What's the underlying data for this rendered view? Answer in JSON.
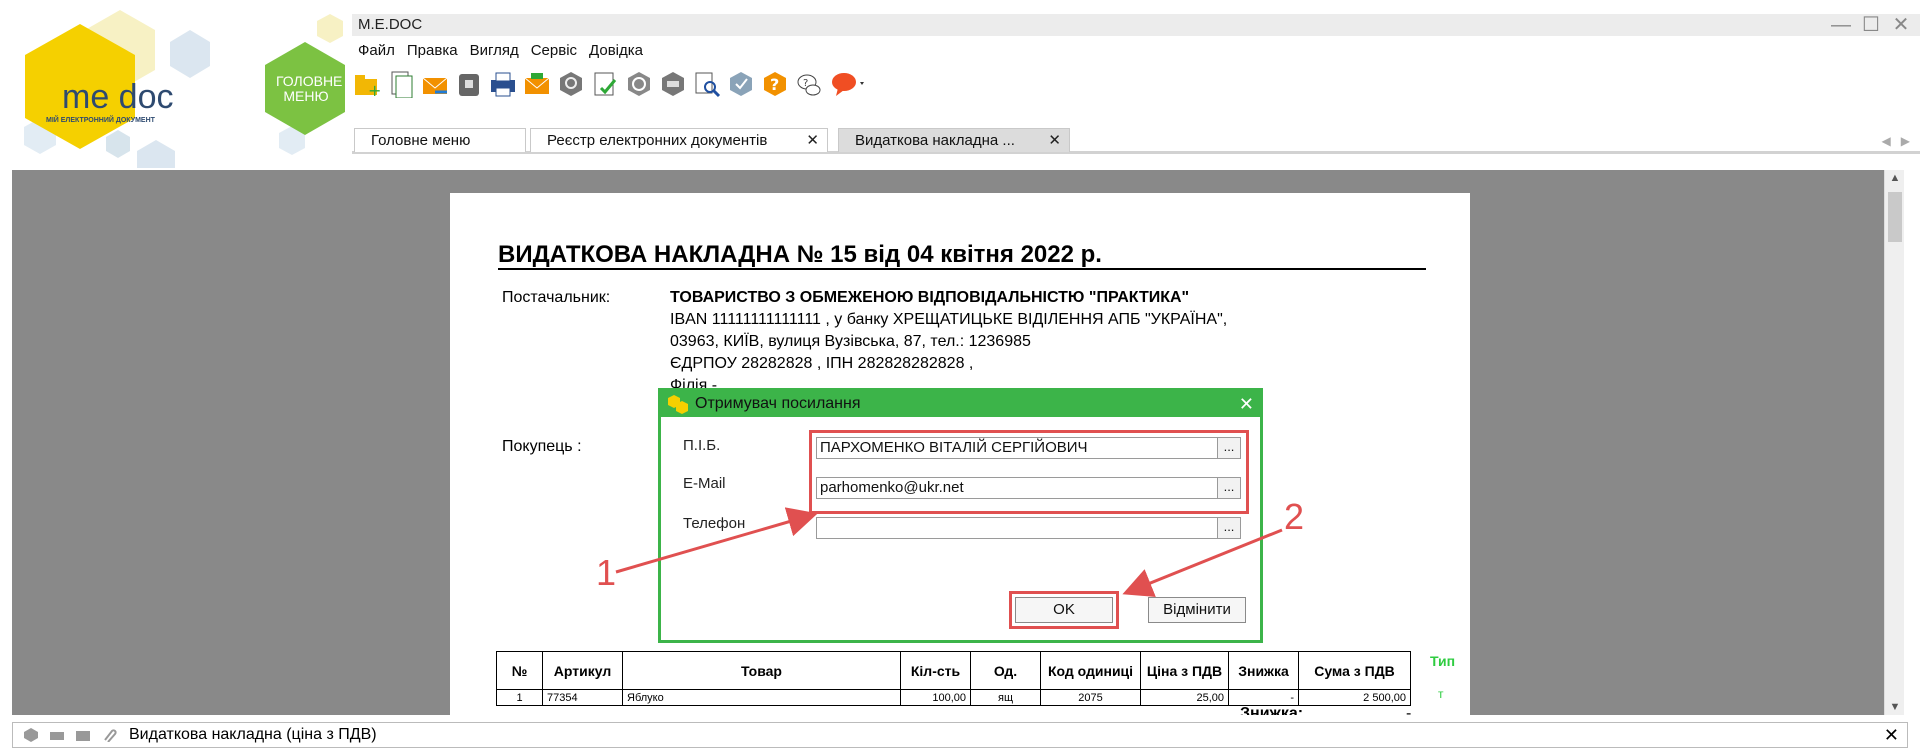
{
  "brand": {
    "logo_text": "me doc",
    "logo_subtitle": "МІЙ ЕЛЕКТРОННИЙ ДОКУМЕНТ",
    "home_label": "ГОЛОВНЕ МЕНЮ"
  },
  "window": {
    "title": "M.E.DOC"
  },
  "menu": [
    "Файл",
    "Правка",
    "Вигляд",
    "Сервіс",
    "Довідка"
  ],
  "toolbar": [
    "add-folder-icon",
    "documents-icon",
    "send-envelope-icon",
    "archive-icon",
    "printer-icon",
    "mail-icon",
    "search-circle-icon",
    "checklist-icon",
    "refresh-icon",
    "inbox-icon",
    "magnifier-doc-icon",
    "certificate-icon",
    "help-icon",
    "chat-icon",
    "comment-icon"
  ],
  "tabs": [
    {
      "label": "Головне меню",
      "closable": false
    },
    {
      "label": "Реєстр електронних документів",
      "closable": true
    },
    {
      "label": "Видаткова накладна ...",
      "closable": true
    }
  ],
  "document": {
    "title": "ВИДАТКОВА НАКЛАДНА  №  15 від 04 квітня 2022 р.",
    "supplier_label": "Постачальник:",
    "supplier_lines": [
      "ТОВАРИСТВО З ОБМЕЖЕНОЮ ВІДПОВІДАЛЬНІСТЮ \"ПРАКТИКА\"",
      "IBAN 11111111111111 , у банку ХРЕЩАТИЦЬКЕ ВІДІЛЕННЯ АПБ \"УКРАЇНА\",",
      "03963, КИЇВ, вулиця Вузівська, 87, тел.: 1236985",
      "ЄДРПОУ 28282828 , ІПН 282828282828 ,",
      "Філія -"
    ],
    "buyer_label": "Покупець :",
    "table_headers": [
      "№",
      "Артикул",
      "Товар",
      "Кіл-сть",
      "Од.",
      "Код одиниці",
      "Ціна з ПДВ",
      "Знижка",
      "Сума з ПДВ"
    ],
    "rows": [
      [
        "1",
        "77354",
        "Яблуко",
        "100,00",
        "ящ",
        "2075",
        "25,00",
        "-",
        "2 500,00"
      ]
    ],
    "side_label": "Тип",
    "side_value": "т",
    "discount_label": "Знижка:",
    "discount_value": "-"
  },
  "dialog": {
    "title": "Отримувач посилання",
    "fields": [
      {
        "label": "П.І.Б.",
        "value": "ПАРХОМЕНКО ВІТАЛІЙ СЕРГІЙОВИЧ"
      },
      {
        "label": "E-Mail",
        "value": "parhomenko@ukr.net"
      },
      {
        "label": "Телефон",
        "value": ""
      }
    ],
    "ellipsis": "...",
    "ok": "OK",
    "cancel": "Відмінити"
  },
  "annotations": {
    "one": "1",
    "two": "2"
  },
  "status": {
    "text": "Видаткова накладна (ціна з ПДВ)"
  },
  "colors": {
    "accent_green": "#3cb449",
    "highlight_red": "#e05050",
    "logo_yellow": "#f5d000"
  }
}
